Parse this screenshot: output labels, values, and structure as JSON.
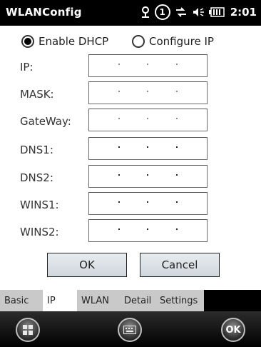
{
  "titlebar": {
    "title": "WLANConfig",
    "clock": "2:01",
    "badge": "1"
  },
  "radios": {
    "dhcp_label": "Enable DHCP",
    "configure_label": "Configure IP",
    "selected": "dhcp"
  },
  "fields": [
    {
      "label": "IP:"
    },
    {
      "label": "MASK:"
    },
    {
      "label": "GateWay:"
    },
    {
      "label": "DNS1:"
    },
    {
      "label": "DNS2:"
    },
    {
      "label": "WINS1:"
    },
    {
      "label": "WINS2:"
    }
  ],
  "buttons": {
    "ok": "OK",
    "cancel": "Cancel"
  },
  "tabs": [
    {
      "label": "Basic"
    },
    {
      "label": "IP"
    },
    {
      "label": "WLAN"
    },
    {
      "label": "Detail"
    },
    {
      "label": "Settings"
    }
  ],
  "bottom": {
    "ok_label": "OK"
  },
  "icons": {
    "status": [
      "connectivity-icon",
      "notification-badge-icon",
      "network-arrows-icon",
      "volume-icon",
      "battery-icon"
    ],
    "bottom": [
      "windows-start-icon",
      "keyboard-icon",
      "ok-icon"
    ]
  },
  "colors": {
    "titlebar_bg": "#000000",
    "button_gradient": "#cfd7dd",
    "tab_active_bg": "#ffffff",
    "tab_inactive_bg": "#c9c9c9"
  }
}
